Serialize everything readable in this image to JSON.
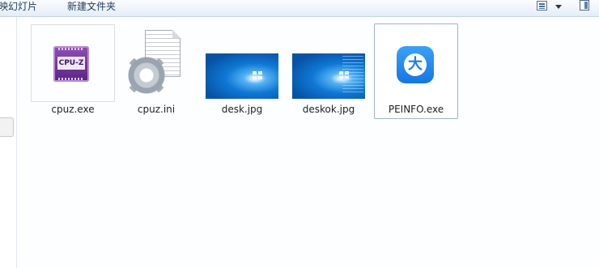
{
  "toolbar": {
    "play_label": "放映幻灯片",
    "new_folder_label": "新建文件夹",
    "icons": [
      "change-view-icon",
      "dropdown-arrow-icon",
      "preview-pane-icon"
    ]
  },
  "files": [
    {
      "name": "cpuz.exe",
      "icon": "cpuz-icon"
    },
    {
      "name": "cpuz.ini",
      "icon": "config-file-icon"
    },
    {
      "name": "desk.jpg",
      "icon": "image-thumbnail"
    },
    {
      "name": "deskok.jpg",
      "icon": "image-thumbnail"
    },
    {
      "name": "PEINFO.exe",
      "icon": "peinfo-icon",
      "selected": true
    }
  ],
  "colors": {
    "selection_border": "#9db3cf",
    "toolbar_bg": "#e3ecf7"
  }
}
